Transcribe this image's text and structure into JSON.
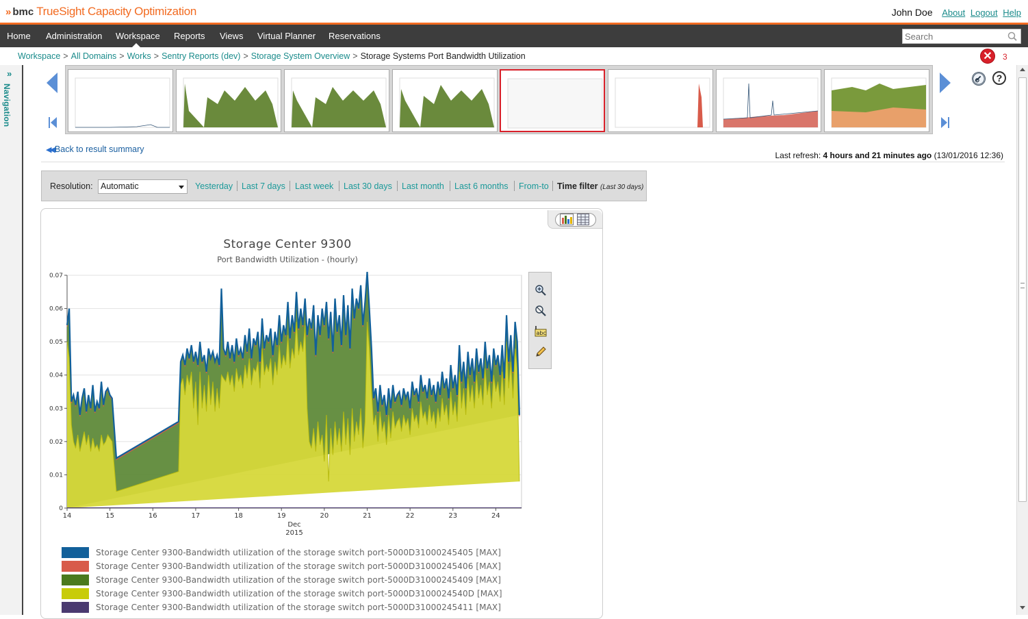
{
  "header": {
    "brand": "bmc",
    "product": "TrueSight Capacity Optimization",
    "user": "John Doe",
    "links": [
      "About",
      "Logout",
      "Help"
    ]
  },
  "nav": {
    "items": [
      "Home",
      "Administration",
      "Workspace",
      "Reports",
      "Views",
      "Virtual Planner",
      "Reservations"
    ],
    "active": "Workspace",
    "search_placeholder": "Search"
  },
  "side_nav": {
    "label": "Navigation",
    "expand_glyph": "»"
  },
  "breadcrumb": {
    "items": [
      "Workspace",
      "All Domains",
      "Works",
      "Sentry Reports (dev)",
      "Storage System Overview"
    ],
    "current": "Storage Systems Port Bandwidth Utilization",
    "separator": ">"
  },
  "alerts": {
    "count": "3",
    "icon": "error-icon",
    "glyph": "✕"
  },
  "thumbnails": {
    "count": 8,
    "selected_index": 4
  },
  "back_link": "Back to result summary",
  "refresh": {
    "label": "Last refresh:",
    "age": "4 hours and 21 minutes ago",
    "timestamp": "(13/01/2016 12:36)"
  },
  "filters": {
    "resolution_label": "Resolution:",
    "resolution_value": "Automatic",
    "links": [
      "Yesterday",
      "Last 7 days",
      "Last week",
      "Last 30 days",
      "Last month",
      "Last 6 months",
      "From-to"
    ],
    "time_filter_label": "Time filter",
    "time_filter_value": "(Last 30 days)"
  },
  "colors": {
    "accent": "#f26b21",
    "link": "#1a9999",
    "series_405": "#12609a",
    "series_406": "#d85b4a",
    "series_409": "#4b7a1e",
    "series_40D": "#c8cc0a",
    "series_411": "#4a3a70"
  },
  "chart_data": {
    "type": "area",
    "title": "Storage Center 9300",
    "subtitle": "Port Bandwidth Utilization - (hourly)",
    "xlabel": "Dec",
    "xlabel_year": "2015",
    "x_ticks": [
      "14",
      "15",
      "16",
      "17",
      "18",
      "19",
      "20",
      "21",
      "22",
      "23",
      "24"
    ],
    "y_ticks": [
      "0",
      "0.01",
      "0.02",
      "0.03",
      "0.04",
      "0.05",
      "0.06",
      "0.07"
    ],
    "ylim": [
      0,
      0.07
    ],
    "xlim": [
      14.0,
      24.6
    ],
    "stacked": true,
    "x": [
      14.0,
      14.05,
      14.1,
      14.15,
      14.2,
      14.25,
      14.3,
      14.35,
      14.4,
      14.45,
      14.5,
      14.55,
      14.6,
      14.65,
      14.7,
      14.75,
      14.8,
      14.85,
      14.9,
      14.95,
      15.0,
      15.05,
      15.15,
      16.6,
      16.65,
      16.7,
      16.75,
      16.8,
      16.85,
      16.9,
      16.95,
      17.0,
      17.05,
      17.1,
      17.15,
      17.2,
      17.25,
      17.3,
      17.35,
      17.4,
      17.45,
      17.5,
      17.55,
      17.6,
      17.65,
      17.7,
      17.75,
      17.8,
      17.85,
      17.9,
      17.95,
      18.0,
      18.05,
      18.1,
      18.15,
      18.2,
      18.25,
      18.3,
      18.35,
      18.4,
      18.45,
      18.5,
      18.55,
      18.6,
      18.65,
      18.7,
      18.75,
      18.8,
      18.85,
      18.9,
      18.95,
      19.0,
      19.05,
      19.1,
      19.15,
      19.2,
      19.25,
      19.3,
      19.35,
      19.4,
      19.45,
      19.5,
      19.55,
      19.6,
      19.65,
      19.7,
      19.75,
      19.8,
      19.85,
      19.9,
      19.95,
      20.0,
      20.05,
      20.1,
      20.15,
      20.2,
      20.25,
      20.3,
      20.35,
      20.4,
      20.45,
      20.5,
      20.55,
      20.6,
      20.65,
      20.7,
      20.75,
      20.8,
      20.85,
      20.9,
      20.95,
      21.0,
      21.05,
      21.1,
      21.15,
      21.2,
      21.25,
      21.3,
      21.35,
      21.4,
      21.45,
      21.5,
      21.55,
      21.6,
      21.65,
      21.7,
      21.75,
      21.8,
      21.85,
      21.9,
      21.95,
      22.0,
      22.05,
      22.1,
      22.15,
      22.2,
      22.25,
      22.3,
      22.35,
      22.4,
      22.45,
      22.5,
      22.55,
      22.6,
      22.65,
      22.7,
      22.75,
      22.8,
      22.85,
      22.9,
      22.95,
      23.0,
      23.05,
      23.1,
      23.15,
      23.2,
      23.25,
      23.3,
      23.35,
      23.4,
      23.45,
      23.5,
      23.55,
      23.6,
      23.65,
      23.7,
      23.75,
      23.8,
      23.85,
      23.9,
      23.95,
      24.0,
      24.05,
      24.1,
      24.15,
      24.2,
      24.25,
      24.3,
      24.35,
      24.4,
      24.45,
      24.5,
      24.55,
      24.6
    ],
    "series": [
      {
        "name": "Storage Center 9300-Bandwidth utilization of the storage switch port-5000D31000245405 [MAX]",
        "color": "#12609a",
        "values": [
          0.055,
          0.06,
          0.032,
          0.034,
          0.031,
          0.035,
          0.028,
          0.033,
          0.036,
          0.029,
          0.034,
          0.03,
          0.037,
          0.029,
          0.032,
          0.03,
          0.038,
          0.031,
          0.035,
          0.036,
          0.034,
          0.033,
          0.015,
          0.026,
          0.044,
          0.046,
          0.043,
          0.048,
          0.045,
          0.049,
          0.044,
          0.047,
          0.043,
          0.05,
          0.044,
          0.046,
          0.041,
          0.048,
          0.045,
          0.047,
          0.044,
          0.046,
          0.043,
          0.066,
          0.048,
          0.046,
          0.05,
          0.045,
          0.049,
          0.044,
          0.051,
          0.046,
          0.048,
          0.045,
          0.052,
          0.047,
          0.054,
          0.045,
          0.051,
          0.049,
          0.053,
          0.044,
          0.057,
          0.048,
          0.052,
          0.05,
          0.054,
          0.046,
          0.053,
          0.049,
          0.058,
          0.05,
          0.055,
          0.052,
          0.062,
          0.051,
          0.058,
          0.053,
          0.065,
          0.054,
          0.06,
          0.055,
          0.063,
          0.052,
          0.057,
          0.054,
          0.061,
          0.046,
          0.058,
          0.052,
          0.06,
          0.055,
          0.062,
          0.051,
          0.059,
          0.047,
          0.063,
          0.053,
          0.058,
          0.049,
          0.064,
          0.052,
          0.061,
          0.048,
          0.066,
          0.057,
          0.063,
          0.06,
          0.067,
          0.055,
          0.062,
          0.071,
          0.06,
          0.048,
          0.033,
          0.036,
          0.029,
          0.037,
          0.031,
          0.034,
          0.028,
          0.036,
          0.03,
          0.037,
          0.032,
          0.034,
          0.035,
          0.031,
          0.036,
          0.033,
          0.035,
          0.03,
          0.038,
          0.034,
          0.036,
          0.032,
          0.04,
          0.035,
          0.037,
          0.033,
          0.039,
          0.034,
          0.037,
          0.032,
          0.038,
          0.034,
          0.041,
          0.036,
          0.039,
          0.033,
          0.043,
          0.036,
          0.04,
          0.034,
          0.049,
          0.038,
          0.044,
          0.036,
          0.047,
          0.04,
          0.045,
          0.038,
          0.048,
          0.041,
          0.045,
          0.039,
          0.05,
          0.042,
          0.046,
          0.038,
          0.048,
          0.043,
          0.046,
          0.04,
          0.049,
          0.039,
          0.058,
          0.044,
          0.052,
          0.041,
          0.056,
          0.05,
          0.028
        ]
      },
      {
        "name": "Storage Center 9300-Bandwidth utilization of the storage switch port-5000D31000245406 [MAX]",
        "color": "#d85b4a",
        "values": null
      },
      {
        "name": "Storage Center 9300-Bandwidth utilization of the storage switch port-5000D31000245409 [MAX]",
        "color": "#4b7a1e",
        "values": null
      },
      {
        "name": "Storage Center 9300-Bandwidth utilization of the storage switch port-5000D3100024540D [MAX]",
        "color": "#c8cc0a",
        "values": [
          0.05,
          0.045,
          0.025,
          0.02,
          0.018,
          0.022,
          0.017,
          0.02,
          0.023,
          0.019,
          0.022,
          0.017,
          0.021,
          0.018,
          0.019,
          0.017,
          0.022,
          0.019,
          0.02,
          0.022,
          0.021,
          0.02,
          0.005,
          0.011,
          0.037,
          0.039,
          0.034,
          0.04,
          0.037,
          0.041,
          0.03,
          0.038,
          0.025,
          0.041,
          0.03,
          0.037,
          0.029,
          0.04,
          0.031,
          0.038,
          0.029,
          0.036,
          0.03,
          0.04,
          0.039,
          0.038,
          0.041,
          0.037,
          0.04,
          0.035,
          0.042,
          0.038,
          0.04,
          0.036,
          0.043,
          0.039,
          0.045,
          0.037,
          0.042,
          0.041,
          0.044,
          0.036,
          0.048,
          0.04,
          0.043,
          0.041,
          0.045,
          0.037,
          0.044,
          0.04,
          0.049,
          0.042,
          0.046,
          0.043,
          0.052,
          0.042,
          0.048,
          0.045,
          0.056,
          0.046,
          0.05,
          0.047,
          0.055,
          0.03,
          0.02,
          0.018,
          0.024,
          0.017,
          0.026,
          0.019,
          0.022,
          0.014,
          0.028,
          0.008,
          0.024,
          0.016,
          0.026,
          0.019,
          0.024,
          0.017,
          0.029,
          0.019,
          0.027,
          0.016,
          0.03,
          0.02,
          0.026,
          0.022,
          0.03,
          0.018,
          0.026,
          0.056,
          0.048,
          0.035,
          0.025,
          0.028,
          0.02,
          0.029,
          0.023,
          0.026,
          0.019,
          0.028,
          0.021,
          0.029,
          0.024,
          0.026,
          0.027,
          0.023,
          0.028,
          0.025,
          0.027,
          0.022,
          0.03,
          0.026,
          0.028,
          0.024,
          0.032,
          0.027,
          0.029,
          0.025,
          0.031,
          0.026,
          0.029,
          0.024,
          0.03,
          0.026,
          0.033,
          0.028,
          0.031,
          0.025,
          0.035,
          0.028,
          0.032,
          0.026,
          0.041,
          0.03,
          0.036,
          0.028,
          0.039,
          0.032,
          0.037,
          0.03,
          0.04,
          0.033,
          0.037,
          0.031,
          0.042,
          0.034,
          0.038,
          0.03,
          0.04,
          0.035,
          0.038,
          0.032,
          0.041,
          0.031,
          0.05,
          0.036,
          0.044,
          0.033,
          0.048,
          0.042,
          0.008
        ]
      },
      {
        "name": "Storage Center 9300-Bandwidth utilization of the storage switch port-5000D31000245411 [MAX]",
        "color": "#4a3a70",
        "values": null
      }
    ],
    "legend_position": "bottom",
    "grid": true
  },
  "chart_tools": [
    "zoom-in-icon",
    "zoom-reset-icon",
    "labels-icon",
    "edit-icon"
  ]
}
